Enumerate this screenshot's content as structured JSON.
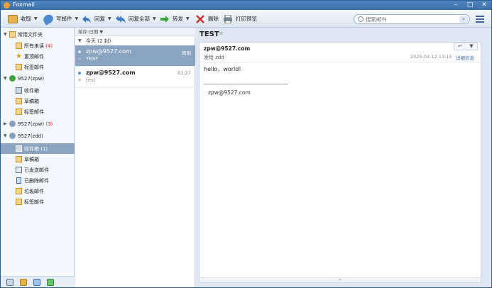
{
  "window": {
    "title": "Foxmail"
  },
  "toolbar": {
    "receive": "收取",
    "compose": "写邮件",
    "reply": "回复",
    "reply_all": "回复全部",
    "forward": "转发",
    "delete": "删除",
    "print_preview": "打印预览"
  },
  "search": {
    "placeholder": "搜索邮件"
  },
  "sidebar": {
    "common": "常用文件夹",
    "all_unread": "所有未读",
    "all_unread_count": "(4)",
    "pinned": "置顶邮件",
    "tagged": "标签邮件",
    "acct1": "9527(zpw)",
    "acct1_inbox": "收件箱",
    "acct1_drafts": "草稿箱",
    "acct1_tagged": "标签邮件",
    "acct2": "9527(zpw)",
    "acct2_count": "(3)",
    "acct3": "9527(zdd)",
    "acct3_inbox": "收件箱",
    "acct3_inbox_count": "(1)",
    "acct3_drafts": "草稿箱",
    "acct3_sent": "已发送邮件",
    "acct3_deleted": "已删除邮件",
    "acct3_junk": "垃圾邮件",
    "acct3_tagged": "标签邮件"
  },
  "list": {
    "sort_label": "排序:日期",
    "group_label": "今天 (2 封)",
    "messages": [
      {
        "sender": "zpw@9527.com",
        "subject": "TEST",
        "time": "刚刚"
      },
      {
        "sender": "zpw@9527.com",
        "subject": "test",
        "time": "01:27"
      }
    ]
  },
  "reader": {
    "subject": "TEST",
    "from": "zpw@9527.com",
    "to": "发给 zdd",
    "date": "2025-04-12 13:15",
    "detail": "详细信息",
    "body": "hello，world!",
    "signature": "zpw@9527.com"
  }
}
